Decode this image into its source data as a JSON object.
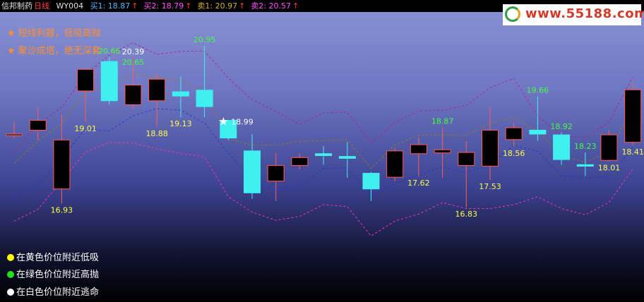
{
  "header": {
    "stock_name": "信邦制药",
    "period": "日线",
    "indicator": "WY004",
    "items": [
      {
        "label": "买1: 18.87",
        "arrow": "↑",
        "color": "#4db8ff"
      },
      {
        "label": "买2: 18.79",
        "arrow": "↑",
        "color": "#ff50ff"
      },
      {
        "label": "卖1: 20.97",
        "arrow": "↑",
        "color": "#d4b030"
      },
      {
        "label": "卖2: 20.57",
        "arrow": "↑",
        "color": "#ff50ff"
      }
    ]
  },
  "logo": {
    "url": "www.55188.com"
  },
  "notes": [
    "★ 短线利器，低吸高抛",
    "★ 聚沙成塔，绝无深套"
  ],
  "legend": [
    {
      "label": "在黄色价位附近低吸",
      "color": "#ffff00"
    },
    {
      "label": "在绿色价位附近高抛",
      "color": "#20e020"
    },
    {
      "label": "在白色价位附近逃命",
      "color": "#ffffff"
    }
  ],
  "chart_data": {
    "type": "candlestick",
    "candles": [
      {
        "o": 18.7,
        "h": 19.02,
        "l": 18.6,
        "c": 18.7,
        "up": true
      },
      {
        "o": 18.8,
        "h": 19.4,
        "l": 18.55,
        "c": 19.05,
        "up": true
      },
      {
        "o": 17.3,
        "h": 19.2,
        "l": 16.93,
        "c": 18.55,
        "up": true
      },
      {
        "o": 19.8,
        "h": 20.4,
        "l": 19.01,
        "c": 20.35,
        "up": true
      },
      {
        "o": 20.55,
        "h": 20.66,
        "l": 19.45,
        "c": 19.55,
        "up": false
      },
      {
        "o": 19.45,
        "h": 20.64,
        "l": 19.35,
        "c": 19.95,
        "up": true
      },
      {
        "o": 19.55,
        "h": 20.25,
        "l": 18.88,
        "c": 20.1,
        "up": true
      },
      {
        "o": 19.78,
        "h": 20.18,
        "l": 19.13,
        "c": 19.67,
        "up": false
      },
      {
        "o": 19.82,
        "h": 20.95,
        "l": 19.13,
        "c": 19.4,
        "up": false
      },
      {
        "o": 19.05,
        "h": 19.05,
        "l": 18.55,
        "c": 18.6,
        "up": false
      },
      {
        "o": 17.2,
        "h": 18.7,
        "l": 17.05,
        "c": 18.27,
        "up": false
      },
      {
        "o": 17.5,
        "h": 18.21,
        "l": 16.99,
        "c": 17.9,
        "up": true
      },
      {
        "o": 17.9,
        "h": 18.2,
        "l": 17.8,
        "c": 18.1,
        "up": true
      },
      {
        "o": 18.15,
        "h": 18.4,
        "l": 17.92,
        "c": 18.2,
        "up": false
      },
      {
        "o": 18.08,
        "h": 18.5,
        "l": 17.58,
        "c": 18.13,
        "up": false
      },
      {
        "o": 17.7,
        "h": 17.73,
        "l": 16.99,
        "c": 17.3,
        "up": false
      },
      {
        "o": 17.6,
        "h": 18.34,
        "l": 17.5,
        "c": 18.27,
        "up": true
      },
      {
        "o": 18.2,
        "h": 18.6,
        "l": 17.62,
        "c": 18.43,
        "up": true
      },
      {
        "o": 18.22,
        "h": 18.87,
        "l": 17.58,
        "c": 18.3,
        "up": true
      },
      {
        "o": 17.9,
        "h": 18.52,
        "l": 16.83,
        "c": 18.23,
        "up": true
      },
      {
        "o": 17.88,
        "h": 19.4,
        "l": 17.53,
        "c": 18.8,
        "up": true
      },
      {
        "o": 18.56,
        "h": 18.99,
        "l": 18.38,
        "c": 18.86,
        "up": true
      },
      {
        "o": 18.8,
        "h": 19.66,
        "l": 18.53,
        "c": 18.7,
        "up": false
      },
      {
        "o": 18.68,
        "h": 18.74,
        "l": 17.91,
        "c": 18.05,
        "up": false
      },
      {
        "o": 17.88,
        "h": 18.23,
        "l": 17.63,
        "c": 17.92,
        "up": false
      },
      {
        "o": 18.03,
        "h": 18.8,
        "l": 18.01,
        "c": 18.68,
        "up": true
      },
      {
        "o": 18.49,
        "h": 20.01,
        "l": 18.41,
        "c": 19.83,
        "up": true
      }
    ],
    "price_labels": [
      {
        "candle": 2,
        "text": "16.93",
        "kind": "low",
        "color": "#ffff40"
      },
      {
        "candle": 3,
        "text": "19.01",
        "kind": "low",
        "color": "#ffff40"
      },
      {
        "candle": 4,
        "text": "20.66",
        "kind": "high",
        "color": "#40ff40"
      },
      {
        "candle": 5,
        "text": "20.39",
        "kind": "high",
        "color": "#ffffff"
      },
      {
        "candle": 5,
        "text": "20.65",
        "kind": "high2",
        "color": "#40ff40"
      },
      {
        "candle": 6,
        "text": "18.88",
        "kind": "low",
        "color": "#ffff40"
      },
      {
        "candle": 7,
        "text": "19.13",
        "kind": "low",
        "color": "#ffff40"
      },
      {
        "candle": 8,
        "text": "20.95",
        "kind": "high",
        "color": "#40ff40"
      },
      {
        "candle": 9,
        "text": "18.99",
        "kind": "star",
        "color": "#ffffff"
      },
      {
        "candle": 17,
        "text": "17.62",
        "kind": "low",
        "color": "#ffff40"
      },
      {
        "candle": 18,
        "text": "18.87",
        "kind": "high",
        "color": "#40ff40"
      },
      {
        "candle": 19,
        "text": "16.83",
        "kind": "low",
        "color": "#ffff40"
      },
      {
        "candle": 20,
        "text": "17.53",
        "kind": "low",
        "color": "#ffff40"
      },
      {
        "candle": 21,
        "text": "18.56",
        "kind": "low",
        "color": "#ffff40"
      },
      {
        "candle": 22,
        "text": "19.66",
        "kind": "high",
        "color": "#40ff40"
      },
      {
        "candle": 23,
        "text": "18.92",
        "kind": "high",
        "color": "#40ff40"
      },
      {
        "candle": 24,
        "text": "18.23",
        "kind": "high",
        "color": "#40ff40"
      },
      {
        "candle": 25,
        "text": "18.01",
        "kind": "low",
        "color": "#ffff40"
      },
      {
        "candle": 26,
        "text": "18.41",
        "kind": "low",
        "color": "#ffff40"
      }
    ],
    "lines": [
      {
        "name": "upper",
        "color": "#b0208a",
        "dash": true,
        "values": [
          18.25,
          18.95,
          19.38,
          20.23,
          20.71,
          21.03,
          20.73,
          20.81,
          20.82,
          20.13,
          19.58,
          19.28,
          18.95,
          19.24,
          19.26,
          18.47,
          18.99,
          19.29,
          19.31,
          19.43,
          19.88,
          20.12,
          19.16,
          18.64,
          18.61,
          19.01,
          20.16
        ]
      },
      {
        "name": "middle",
        "color": "#9a7a20",
        "dash": true,
        "values": [
          17.95,
          18.52,
          18.97,
          19.78,
          19.95,
          20.23,
          20.13,
          20.08,
          19.76,
          18.57,
          18.42,
          18.42,
          18.52,
          18.53,
          18.56,
          17.82,
          18.42,
          18.67,
          18.67,
          18.66,
          18.98,
          19.13,
          18.78,
          18.16,
          17.98,
          18.26,
          19.38
        ]
      },
      {
        "name": "lower",
        "color": "#1a3ad0",
        "dash": true,
        "values": [
          17.08,
          17.4,
          18.09,
          18.83,
          18.78,
          19.17,
          19.35,
          19.31,
          18.98,
          18.21,
          17.54,
          17.25,
          17.39,
          17.82,
          17.84,
          17.14,
          17.43,
          17.67,
          17.86,
          17.72,
          17.92,
          18.42,
          18.26,
          17.64,
          17.58,
          17.62,
          18.37
        ]
      },
      {
        "name": "bottom",
        "color": "#ff30c0",
        "dash": true,
        "values": [
          16.48,
          16.78,
          17.51,
          18.24,
          18.49,
          18.47,
          18.32,
          18.21,
          18.12,
          17.1,
          16.71,
          16.5,
          16.6,
          16.9,
          16.85,
          16.1,
          16.48,
          16.66,
          16.95,
          16.8,
          16.8,
          16.9,
          17.1,
          16.8,
          16.64,
          16.96,
          17.81
        ]
      }
    ]
  }
}
